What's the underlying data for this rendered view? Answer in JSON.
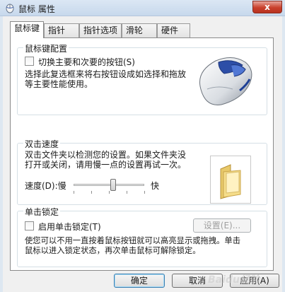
{
  "window": {
    "title": "鼠标 属性",
    "close_label": "x"
  },
  "tabs": [
    {
      "label": "鼠标键",
      "active": true
    },
    {
      "label": "指针",
      "active": false
    },
    {
      "label": "指针选项",
      "active": false
    },
    {
      "label": "滑轮",
      "active": false
    },
    {
      "label": "硬件",
      "active": false
    }
  ],
  "button_config": {
    "group_title": "鼠标键配置",
    "switch_checkbox_label": "切换主要和次要的按钮(S)",
    "switch_checked": false,
    "description_line1": "选择此复选框来将右按钮设成如选择和拖放",
    "description_line2": "等主要性能使用。"
  },
  "double_click": {
    "group_title": "双击速度",
    "description_line1": "双击文件夹以检测您的设置。如果文件夹没",
    "description_line2": "打开或关闭，请用慢一点的设置再试一次。",
    "speed_label": "速度(D):慢",
    "fast_label": "快",
    "speed_level": 0.56
  },
  "click_lock": {
    "group_title": "单击锁定",
    "enable_checkbox_label": "启用单击锁定(T)",
    "enable_checked": false,
    "settings_button": "设置(E)...",
    "description_line1": "使您可以不用一直按着鼠标按钮就可以高亮显示或拖拽。单击",
    "description_line2": "鼠标以进入锁定状态，再次单击鼠标可解除锁定。"
  },
  "footer": {
    "ok_label": "确定",
    "cancel_label": "取消",
    "apply_label": "应用(A)"
  },
  "watermark": "Baidu经验",
  "colors": {
    "title_gradient_top": "#dbe7f4",
    "close_red": "#c9402c",
    "default_button_border": "#3c7fb1"
  }
}
